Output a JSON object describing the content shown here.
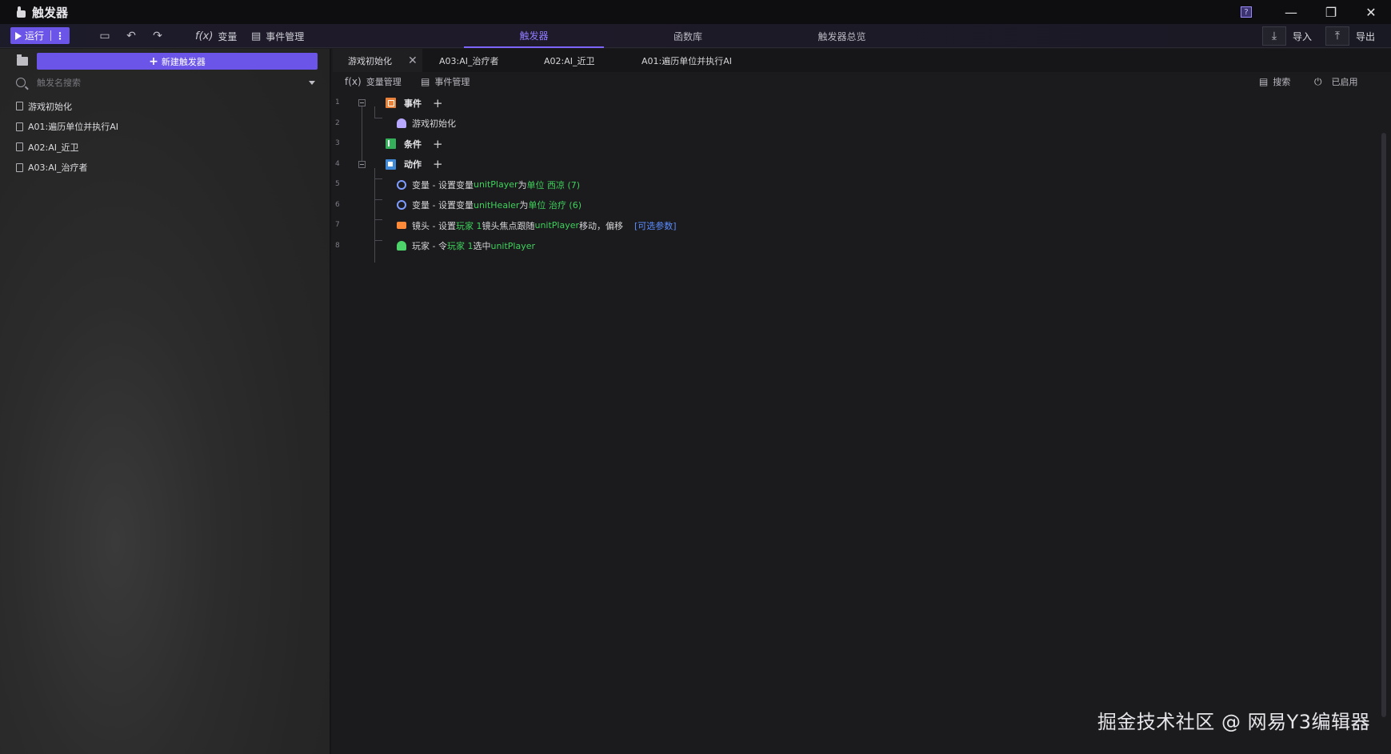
{
  "window": {
    "title": "触发器",
    "controls": {
      "help": "?",
      "minimize": "—",
      "restore": "❐",
      "close": "✕"
    }
  },
  "toolbar": {
    "run_label": "运行",
    "run_more": "⋮",
    "variables_label": "变量",
    "event_manage_label": "事件管理",
    "tabs": [
      {
        "label": "触发器",
        "active": true
      },
      {
        "label": "函数库",
        "active": false
      },
      {
        "label": "触发器总览",
        "active": false
      }
    ],
    "import_label": "导入",
    "export_label": "导出"
  },
  "left_panel": {
    "new_trigger_label": "新建触发器",
    "search_placeholder": "触发名搜索",
    "items": [
      {
        "label": "游戏初始化"
      },
      {
        "label": "A01:遍历单位并执行AI"
      },
      {
        "label": "A02:AI_近卫"
      },
      {
        "label": "A03:AI_治疗者"
      }
    ]
  },
  "doc_tabs": [
    {
      "label": "游戏初始化",
      "active": true
    },
    {
      "label": "A03:AI_治疗者",
      "active": false
    },
    {
      "label": "A02:AI_近卫",
      "active": false
    },
    {
      "label": "A01:遍历单位并执行AI",
      "active": false
    }
  ],
  "sub_toolbar": {
    "var_manage": "变量管理",
    "event_manage": "事件管理",
    "search": "搜索",
    "enabled": "已启用"
  },
  "editor": {
    "line_numbers": [
      "1",
      "2",
      "3",
      "4",
      "5",
      "6",
      "7",
      "8"
    ],
    "event_label": "事件",
    "event_item": "游戏初始化",
    "condition_label": "条件",
    "action_label": "动作",
    "row5": {
      "prefix": "变量 - 设置变量 ",
      "var": "unitPlayer",
      "mid": " 为 ",
      "value": "单位 西凉 (7)"
    },
    "row6": {
      "prefix": "变量 - 设置变量 ",
      "var": "unitHealer",
      "mid": " 为 ",
      "value": "单位 治疗 (6)"
    },
    "row7": {
      "prefix": "镜头 - 设置 ",
      "player": "玩家 1",
      "mid": " 镜头焦点跟随 ",
      "var": "unitPlayer",
      "suffix": " 移动，偏移",
      "optional": "[可选参数]"
    },
    "row8": {
      "prefix": "玩家 - 令 ",
      "player": "玩家 1",
      "mid": " 选中 ",
      "var": "unitPlayer"
    }
  },
  "watermark": "掘金技术社区 @ 网易Y3编辑器",
  "colors": {
    "accent": "#6b55e8",
    "accent_text": "#8f7bff",
    "green": "#3fd15c",
    "link": "#5b8cff"
  }
}
